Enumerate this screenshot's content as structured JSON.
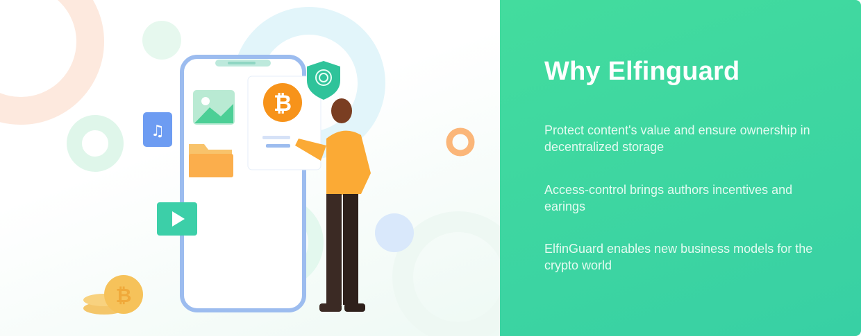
{
  "illustration": {
    "icons": [
      "fingerprint-shield-icon",
      "bitcoin-icon",
      "image-icon",
      "music-file-icon",
      "folder-icon",
      "video-icon",
      "coin-stack-icon"
    ],
    "colors": {
      "phone": "#8fb6ee",
      "bitcoin": "#f7931a",
      "shield": "#2fc39a"
    }
  },
  "panel": {
    "title": "Why Elfinguard",
    "points": [
      "Protect content's value and ensure ownership in decentralized storage",
      "Access-control brings authors incentives and earings",
      "ElfinGuard enables new business models for the crypto world"
    ],
    "colors": {
      "background": "#3ed6a0",
      "text": "#ffffff"
    }
  }
}
